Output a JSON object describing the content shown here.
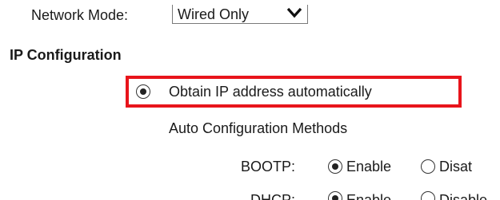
{
  "network_mode": {
    "label": "Network Mode:",
    "selected_value": "Wired Only"
  },
  "ip_configuration": {
    "heading": "IP Configuration",
    "obtain_automatically": {
      "label": "Obtain IP address automatically",
      "checked": true
    },
    "auto_config_methods_label": "Auto Configuration Methods",
    "bootp": {
      "label": "BOOTP:",
      "enable_label": "Enable",
      "disable_label": "Disat",
      "selected": "Enable"
    },
    "dhcp": {
      "label": "DHCP:",
      "enable_label": "Enable",
      "disable_label": "Disable"
    }
  },
  "colors": {
    "highlight": "#e8141b",
    "text": "#1a1a1a"
  },
  "icons": {
    "select_chevron": "chevron-down-icon"
  }
}
